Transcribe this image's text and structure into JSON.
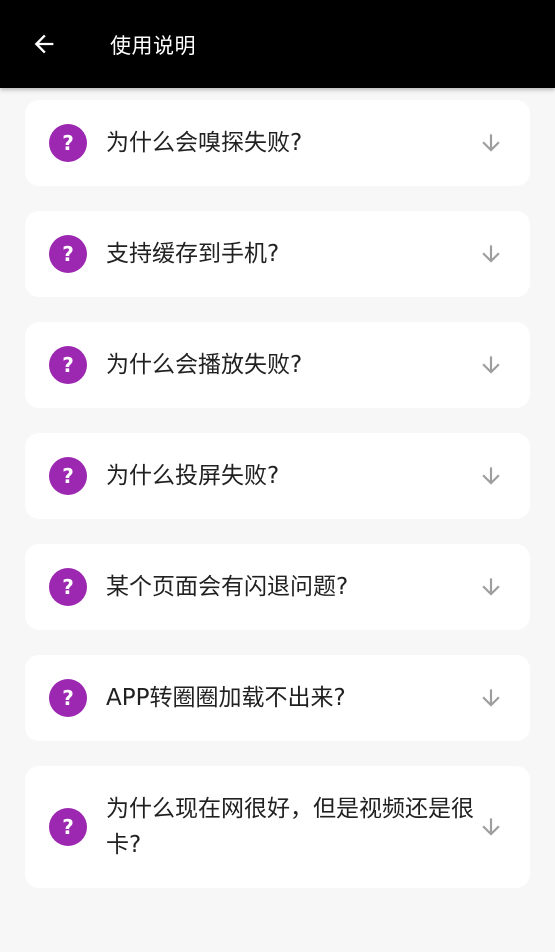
{
  "header": {
    "title": "使用说明"
  },
  "faq": {
    "badge": "?",
    "items": [
      {
        "question": "为什么会嗅探失败?"
      },
      {
        "question": "支持缓存到手机?"
      },
      {
        "question": "为什么会播放失败?"
      },
      {
        "question": "为什么投屏失败?"
      },
      {
        "question": "某个页面会有闪退问题?"
      },
      {
        "question": "APP转圈圈加载不出来?"
      },
      {
        "question": "为什么现在网很好，但是视频还是很卡?"
      }
    ]
  },
  "colors": {
    "app_bar": "#000000",
    "background": "#f7f7f7",
    "badge": "#9c27b0",
    "chevron": "#9e9e9e"
  },
  "icons": {
    "back": "arrow-left-icon",
    "expand": "arrow-down-icon"
  }
}
